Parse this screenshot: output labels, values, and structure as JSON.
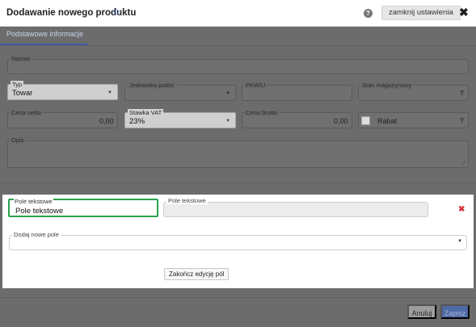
{
  "header": {
    "title": "Dodawanie nowego produktu",
    "star_icon": "star-outline-icon",
    "help_icon": "question-circle-icon",
    "help_glyph": "?",
    "close_settings_label": "zamknij ustawienia",
    "close_glyph": "✖"
  },
  "tabs": [
    {
      "label": "Podstawowe informacje",
      "active": true
    }
  ],
  "form": {
    "nazwa": {
      "label": "Nazwa",
      "value": ""
    },
    "typ": {
      "label": "Typ",
      "value": "Towar"
    },
    "jednostka": {
      "label": "Jednostka podst.",
      "value": ""
    },
    "pkwiu": {
      "label": "PKWiU",
      "value": ""
    },
    "stan": {
      "label": "Stan magazynowy",
      "hint": "?"
    },
    "cena_netto": {
      "label": "Cena netto",
      "value": "0,00"
    },
    "stawka_vat": {
      "label": "Stawka VAT",
      "value": "23%"
    },
    "cena_brutto": {
      "label": "Cena brutto",
      "value": "0,00"
    },
    "rabat": {
      "label": "Rabat",
      "checked": false,
      "hint": "?"
    },
    "opis": {
      "label": "Opis",
      "value": ""
    }
  },
  "custom_fields": {
    "field1": {
      "label": "Pole tekstowe",
      "value": "Pole tekstowe"
    },
    "field2": {
      "label": "Pole tekstowe",
      "value": ""
    },
    "remove_glyph": "✖",
    "add_label": "Dodaj nowe pole",
    "finish_label": "Zakończ edycję pól"
  },
  "footer": {
    "cancel_label": "Anuluj",
    "save_label": "Zapisz"
  },
  "colors": {
    "accent": "#3b6fd4",
    "focus": "#2aa14e",
    "danger": "#d9343a",
    "save": "#4d6aa6"
  }
}
